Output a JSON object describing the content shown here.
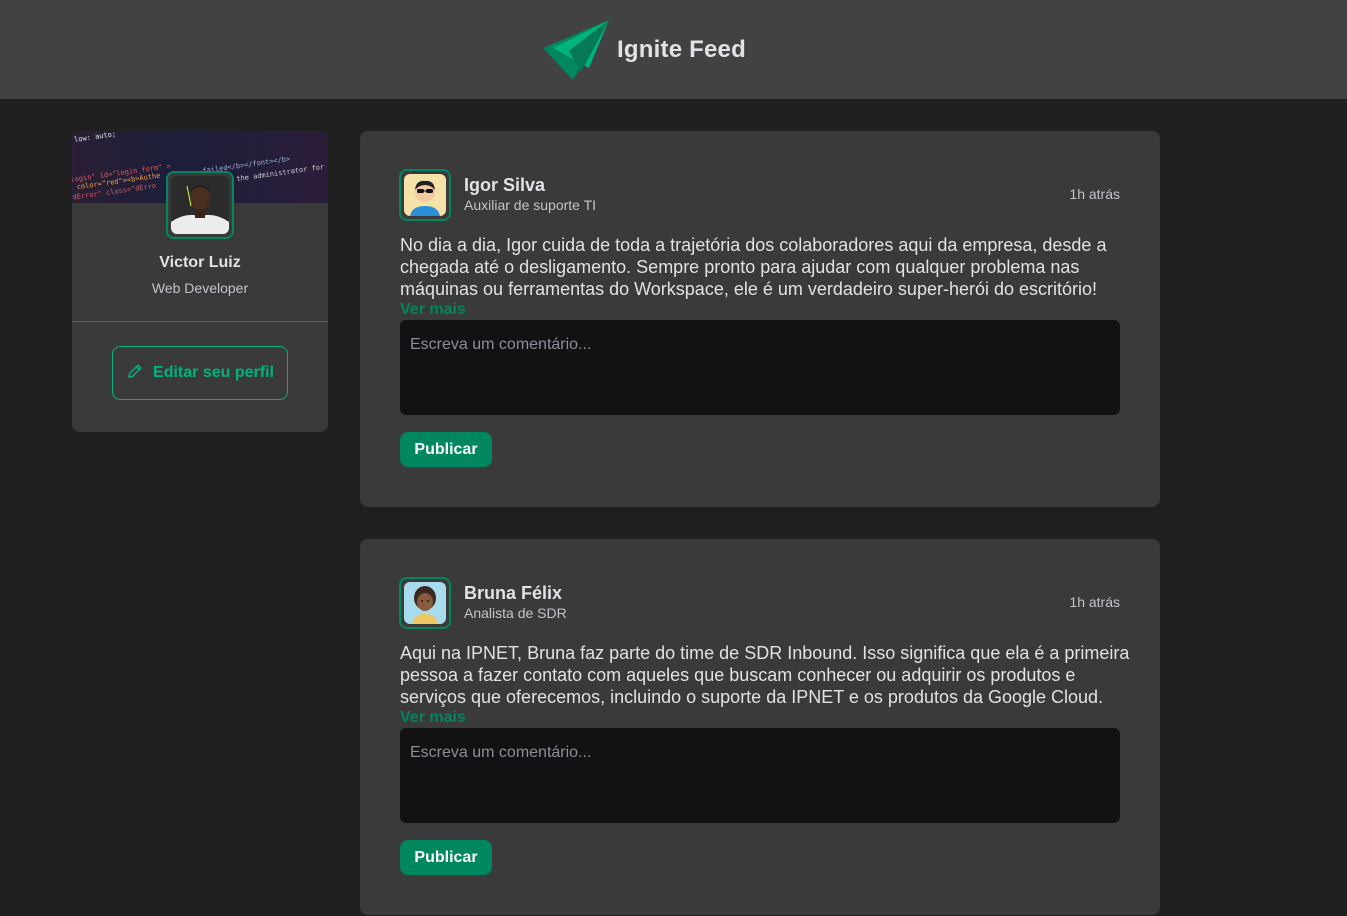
{
  "header": {
    "title": "Ignite Feed",
    "logo_icon": "ignite-logo-icon",
    "background": "#424242"
  },
  "sidebar": {
    "name": "Victor Luiz",
    "role": "Web Developer",
    "edit_label": "Editar seu perfil",
    "edit_icon": "pencil-icon",
    "cover_code": [
      "low: auto;",
      "login\" id=\"login_form\" >",
      "t color=\"red\"><b>Authe",
      "\"dError\" class=\"dErro",
      "failed</b></font></b>",
      "the administrator for"
    ]
  },
  "posts": [
    {
      "author": "Igor Silva",
      "role": "Auxiliar de suporte TI",
      "time": "1h atrás",
      "content": "No dia a dia, Igor cuida de toda a trajetória dos colaboradores aqui da empresa, desde a chegada até o desligamento. Sempre pronto para ajudar com qualquer problema nas máquinas ou ferramentas do Workspace, ele é um verdadeiro super-herói do escritório!",
      "more": "Ver mais",
      "comment_placeholder": "Escreva um comentário...",
      "publish_label": "Publicar"
    },
    {
      "author": "Bruna Félix",
      "role": "Analista de SDR",
      "time": "1h atrás",
      "content": "Aqui na IPNET, Bruna faz parte do time de SDR Inbound. Isso significa que ela é a primeira pessoa a fazer contato com aqueles que buscam conhecer ou adquirir os produtos e serviços que oferecemos, incluindo o suporte da IPNET e os produtos da Google Cloud.",
      "more": "Ver mais",
      "comment_placeholder": "Escreva um comentário...",
      "publish_label": "Publicar"
    }
  ],
  "colors": {
    "accent": "#00875f",
    "accent_light": "#00b37e",
    "page_bg": "#202020",
    "card_bg": "#3a3a3a",
    "input_bg": "#121214"
  }
}
